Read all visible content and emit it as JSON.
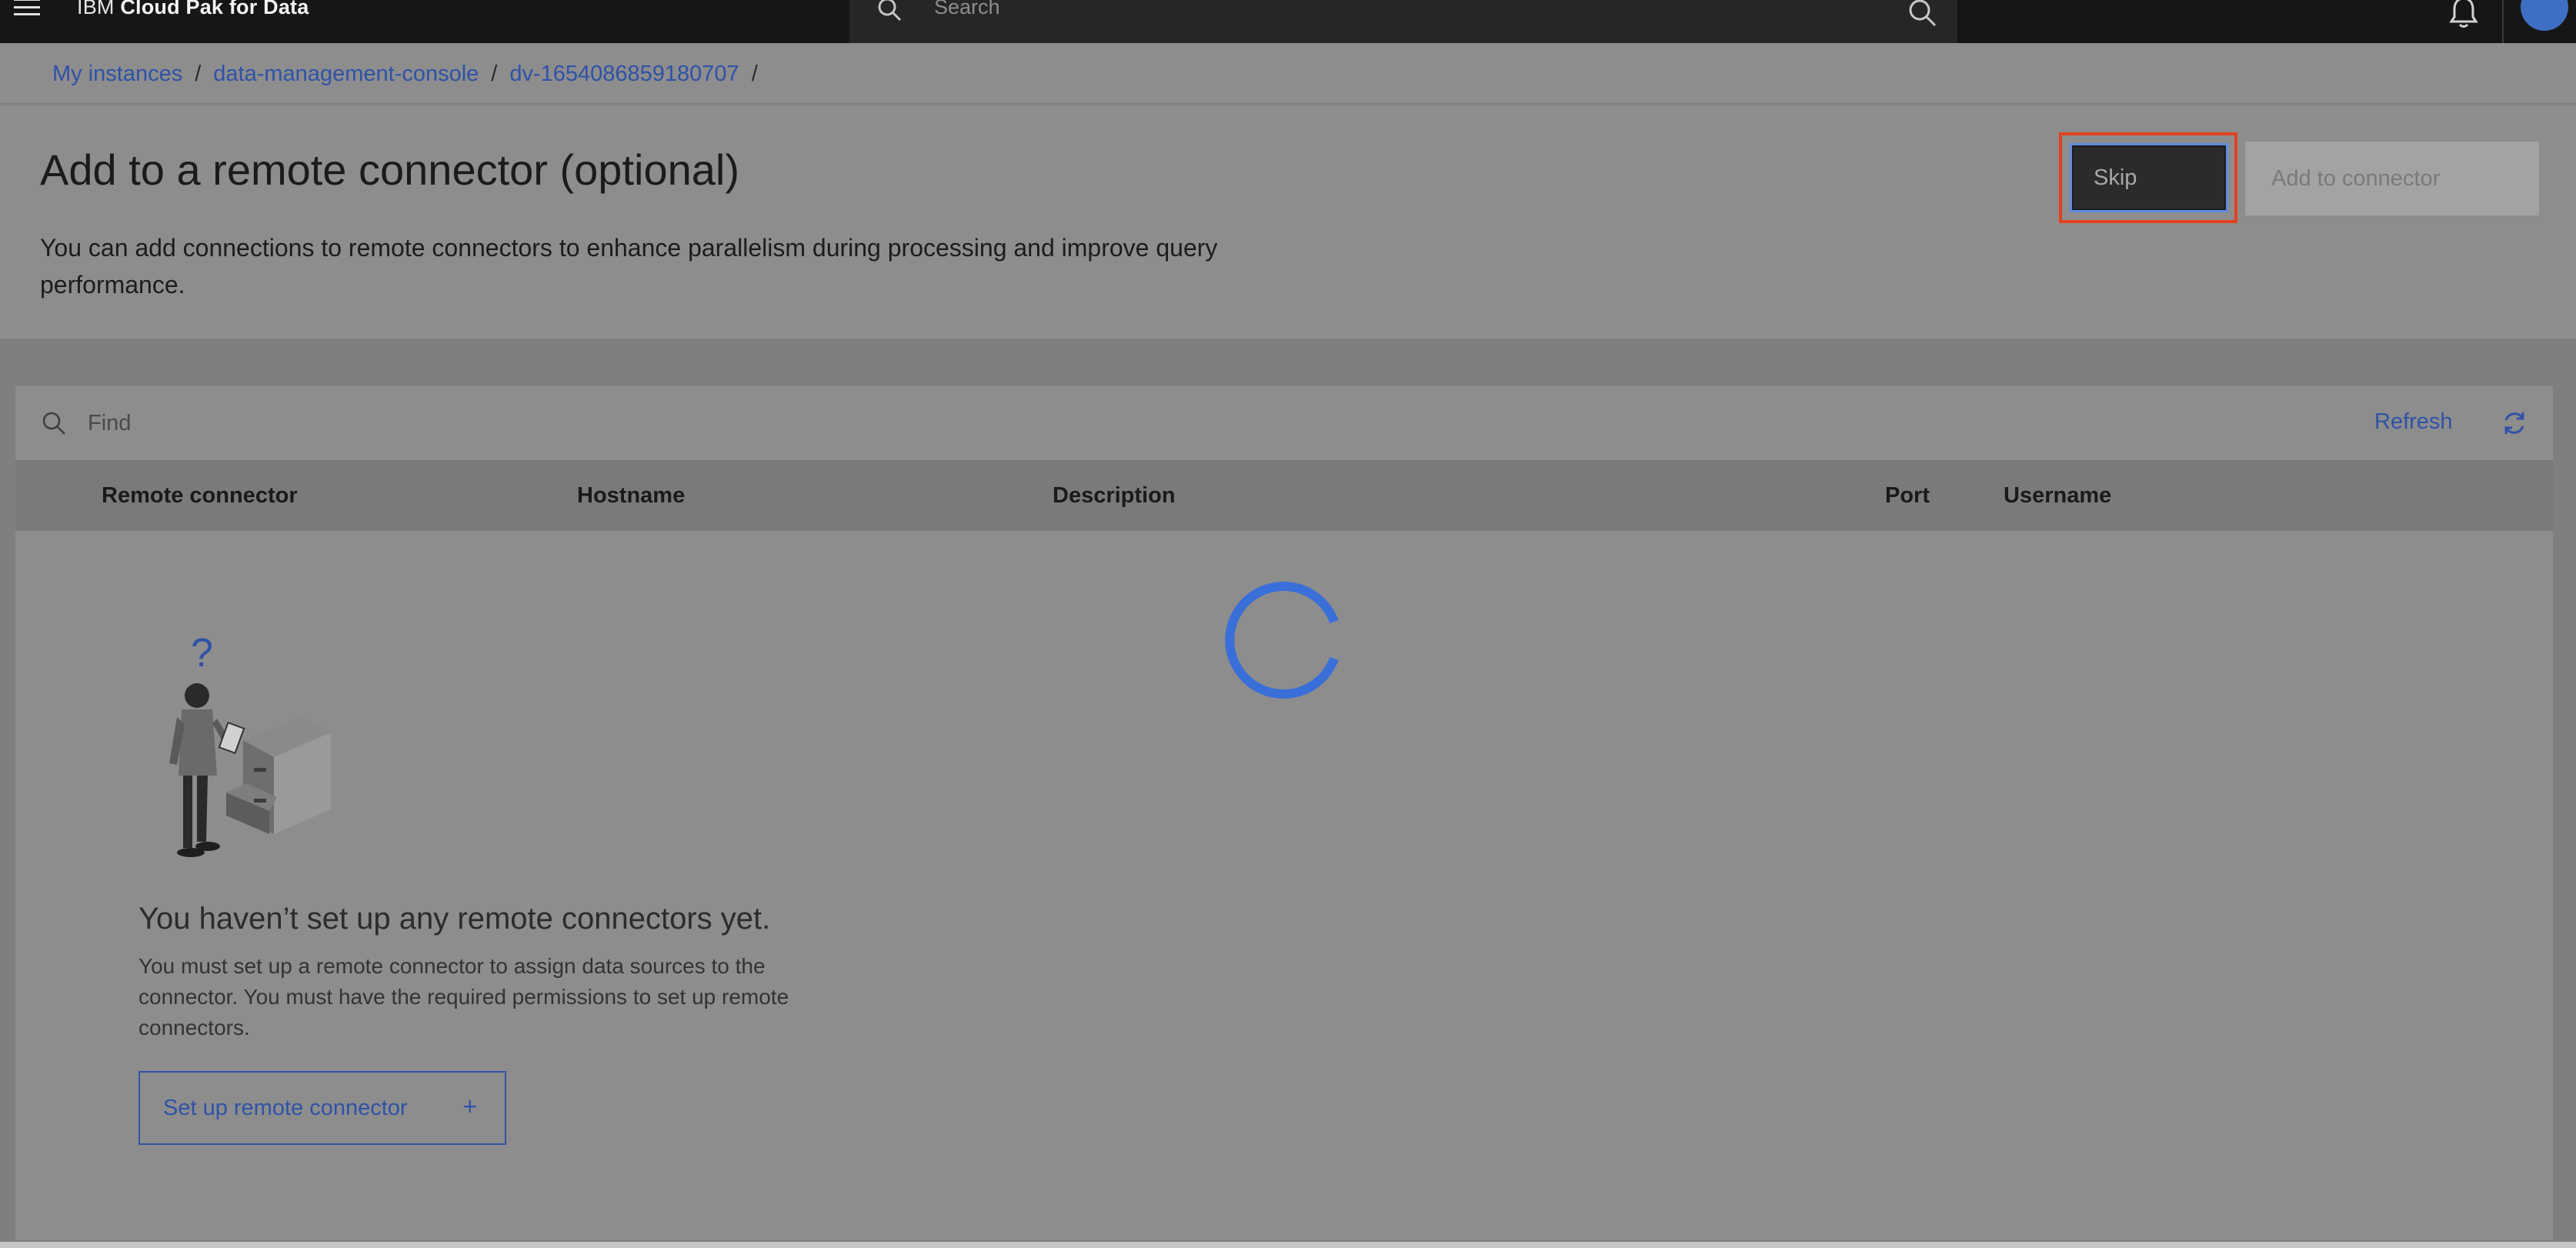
{
  "header": {
    "brand_prefix": "IBM",
    "brand_name": "Cloud Pak for Data",
    "search_placeholder": "Search"
  },
  "breadcrumb": {
    "items": [
      "My instances",
      "data-management-console",
      "dv-1654086859180707"
    ],
    "separator": "/"
  },
  "page": {
    "title": "Add to a remote connector (optional)",
    "description": "You can add connections to remote connectors to enhance parallelism during processing and improve query performance.",
    "skip_label": "Skip",
    "add_label": "Add to connector"
  },
  "table": {
    "find_placeholder": "Find",
    "refresh_label": "Refresh",
    "columns": [
      "Remote connector",
      "Hostname",
      "Description",
      "Port",
      "Username"
    ]
  },
  "empty_state": {
    "title": "You haven’t set up any remote connectors yet.",
    "description": "You must set up a remote connector to assign data sources to the connector. You must have the required permissions to set up remote connectors.",
    "button_label": "Set up remote connector",
    "button_icon": "+"
  },
  "colors": {
    "link": "#2f52a8",
    "spinner": "#3a6fd9",
    "focus_outline": "#e0431f",
    "header_bg": "#161616"
  }
}
